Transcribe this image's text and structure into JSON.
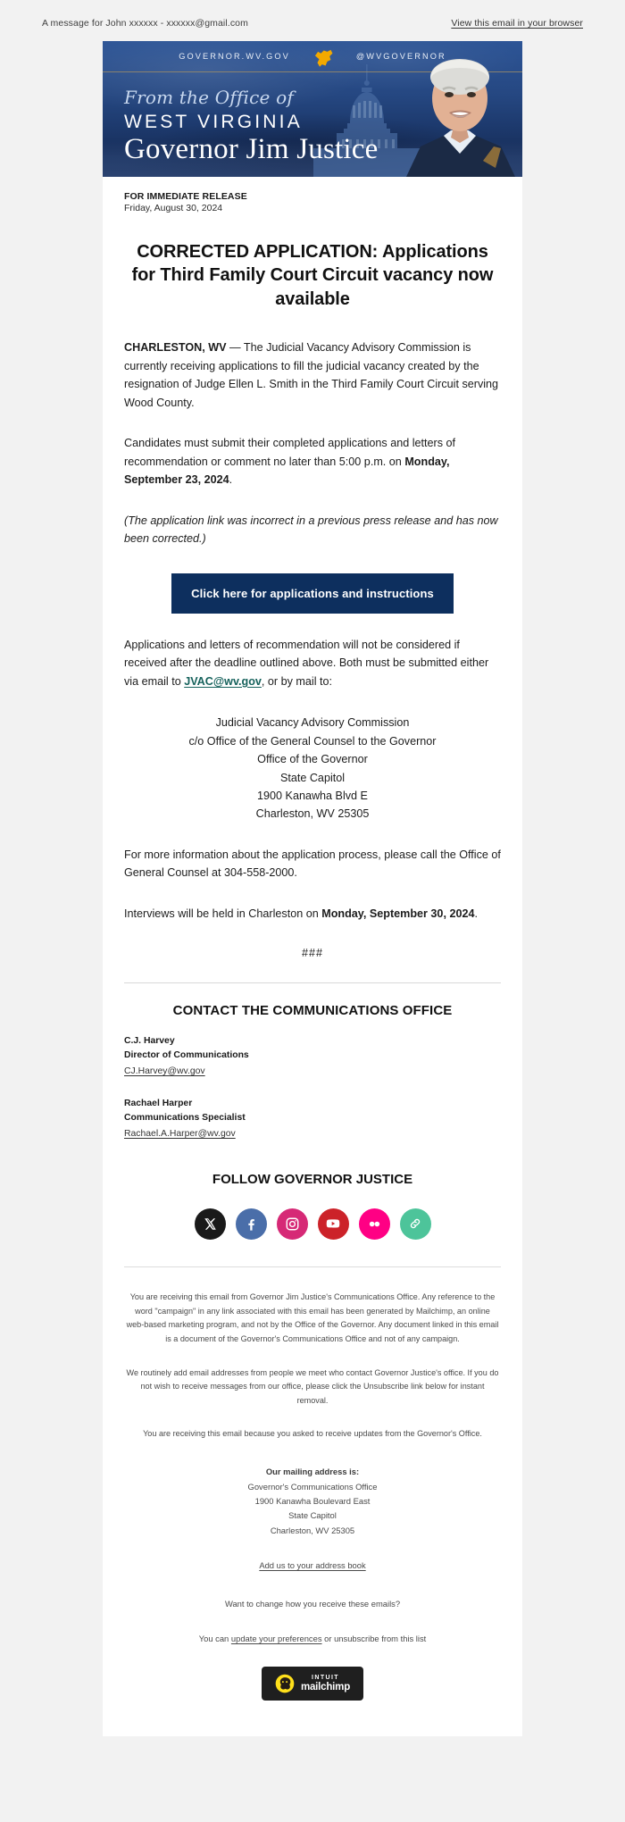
{
  "preheader": {
    "message": "A message for John xxxxxx - xxxxxx@gmail.com",
    "view_in_browser": "View this email in your browser"
  },
  "banner": {
    "website": "GOVERNOR.WV.GOV",
    "handle": "@WVGOVERNOR",
    "from_line": "From the Office of",
    "state": "WEST VIRGINIA",
    "governor": "Governor Jim Justice",
    "colors": {
      "navy": "#1d3a6e",
      "gold": "#f2a900",
      "rule": "#9a8b68"
    }
  },
  "release": {
    "label": "FOR IMMEDIATE RELEASE",
    "date": "Friday, August 30, 2024",
    "headline": "CORRECTED APPLICATION: Applications for Third Family Court Circuit vacancy now available"
  },
  "body": {
    "p1_lead": "CHARLESTON, WV",
    "p1_rest": " — The Judicial Vacancy Advisory Commission is currently receiving applications to fill the judicial vacancy created by the resignation of Judge Ellen L. Smith in the Third Family Court Circuit serving Wood County.",
    "p2_a": "Candidates must submit their completed applications and letters of recommendation or comment no later than 5:00 p.m. on ",
    "p2_b": "Monday, September 23, 2024",
    "p2_c": ".",
    "p3_note": "(The application link was incorrect in a previous press release and has now been corrected.)",
    "cta_label": "Click here for applications and instructions",
    "p4_a": "Applications and letters of recommendation will not be considered if received after the deadline outlined above. Both must be submitted either via email to ",
    "p4_email": "JVAC@wv.gov",
    "p4_b": ", or by mail to:",
    "address": [
      "Judicial Vacancy Advisory Commission",
      "c/o Office of the General Counsel to the Governor",
      "Office of the Governor",
      "State Capitol",
      "1900 Kanawha Blvd E",
      "Charleston, WV 25305"
    ],
    "p5": "For more information about the application process, please call the Office of General Counsel at 304-558-2000.",
    "p6_a": "Interviews will be held in Charleston on ",
    "p6_b": "Monday, September 30, 2024",
    "p6_c": ".",
    "end_marks": "###"
  },
  "contact": {
    "title": "CONTACT THE COMMUNICATIONS OFFICE",
    "people": [
      {
        "name": "C.J. Harvey",
        "role": "Director of Communications",
        "email": "CJ.Harvey@wv.gov"
      },
      {
        "name": "Rachael Harper",
        "role": "Communications Specialist",
        "email": "Rachael.A.Harper@wv.gov"
      }
    ]
  },
  "follow": {
    "title": "FOLLOW GOVERNOR JUSTICE",
    "icons": [
      {
        "name": "x-twitter-icon",
        "color": "#1a1a1a"
      },
      {
        "name": "facebook-icon",
        "color": "#4a6ea9"
      },
      {
        "name": "instagram-icon",
        "color": "#d62976"
      },
      {
        "name": "youtube-icon",
        "color": "#cc2229"
      },
      {
        "name": "flickr-icon",
        "color": "#ff0084"
      },
      {
        "name": "link-icon",
        "color": "#4dc49a"
      }
    ]
  },
  "legal": {
    "p1": "You are receiving this email from Governor Jim Justice's Communications Office. Any reference to the word \"campaign\" in any link associated with this email has been generated by Mailchimp, an online web-based marketing program, and not by the Office of the Governor. Any document linked in this email is a document of the Governor's Communications Office and not of any campaign.",
    "p2": "We routinely add email addresses from people we meet who contact Governor Justice's office. If you do not wish to receive messages from our office, please click the Unsubscribe link below for instant removal.",
    "p3": "You are receiving this email because you asked to receive updates from the Governor's Office.",
    "mail_title": "Our mailing address is:",
    "mail_lines": [
      "Governor's Communications Office",
      "1900 Kanawha Boulevard East",
      "State Capitol",
      "Charleston, WV 25305"
    ],
    "address_book": "Add us to your address book",
    "prefs_line1": "Want to change how you receive these emails?",
    "prefs_a": "You can ",
    "prefs_link": "update your preferences",
    "prefs_b": " or unsubscribe from this list",
    "mailchimp_l1": "INTUIT",
    "mailchimp_l2": "mailchimp"
  }
}
